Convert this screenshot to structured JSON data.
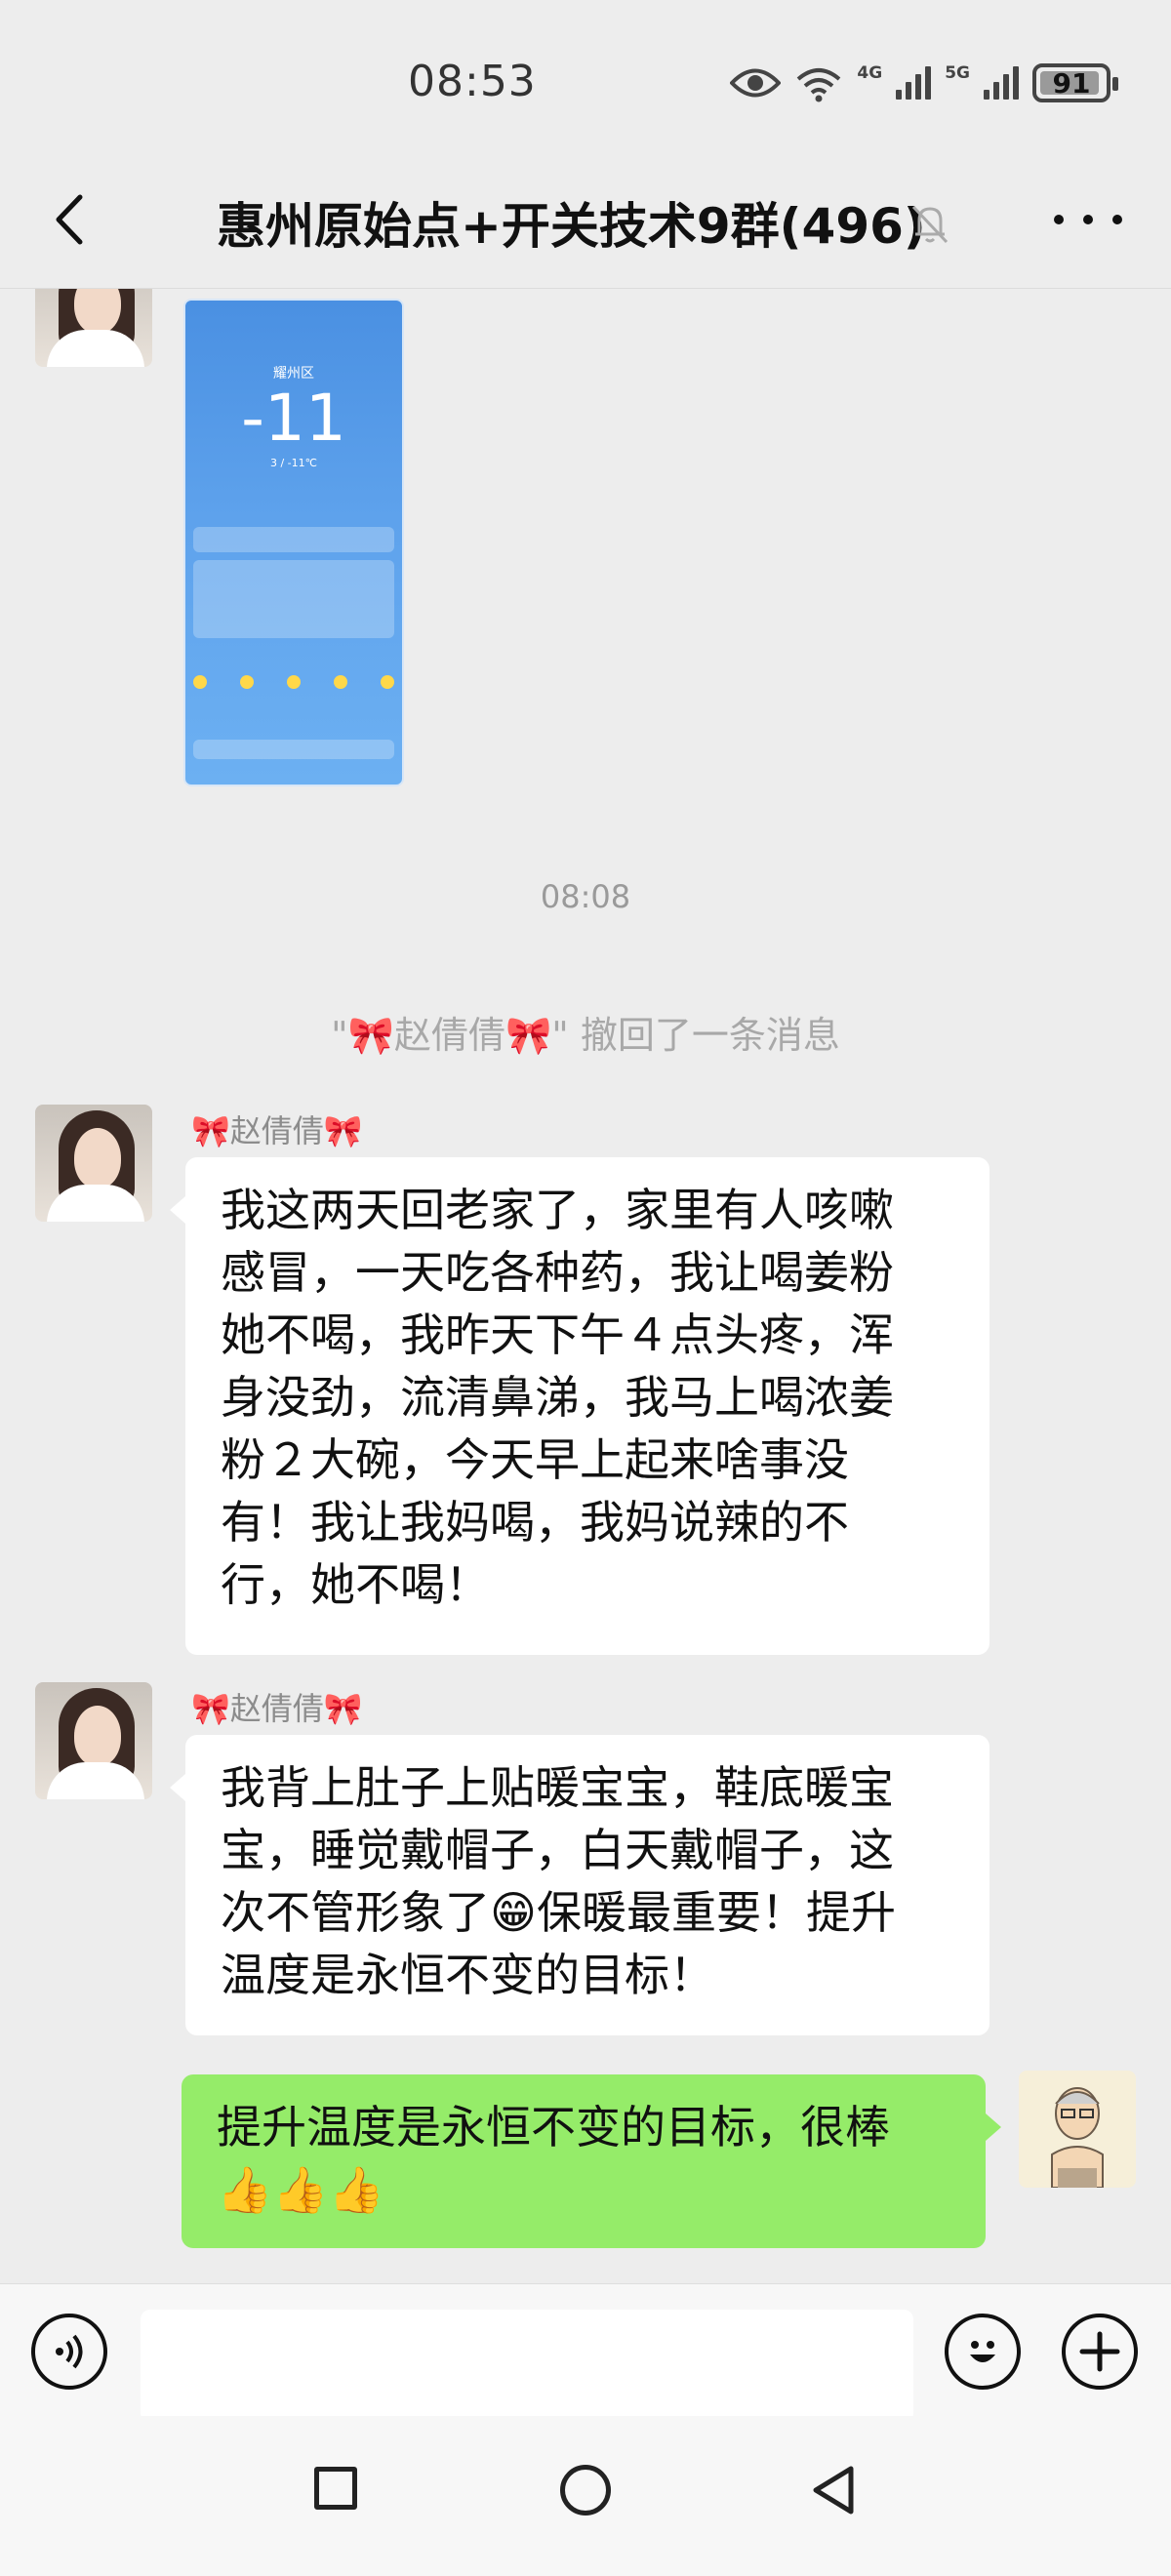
{
  "status": {
    "time": "08:53",
    "signal1_label": "4G",
    "signal2_label": "5G",
    "battery": "91"
  },
  "header": {
    "title": "惠州原始点+开关技术9群(496)"
  },
  "weather_screenshot": {
    "city": "耀州区",
    "temp": "-11",
    "range": "3 / -11℃"
  },
  "messages": {
    "timestamp": "08:08",
    "recall_notice": "\"🎀赵倩倩🎀\" 撤回了一条消息",
    "msg1": {
      "sender": "🎀赵倩倩🎀",
      "text": "我这两天回老家了，家里有人咳嗽\n感冒，一天吃各种药，我让喝姜粉\n她不喝，我昨天下午４点头疼，浑\n身没劲，流清鼻涕，我马上喝浓姜\n粉２大碗，今天早上起来啥事没\n有！我让我妈喝，我妈说辣的不\n行，她不喝！"
    },
    "msg2": {
      "sender": "🎀赵倩倩🎀",
      "text": "我背上肚子上贴暖宝宝，鞋底暖宝\n宝，睡觉戴帽子，白天戴帽子，这\n次不管形象了😁保暖最重要！提升\n温度是永恒不变的目标！"
    },
    "msg3": {
      "text": "提升温度是永恒不变的目标，很棒\n👍👍👍"
    }
  }
}
